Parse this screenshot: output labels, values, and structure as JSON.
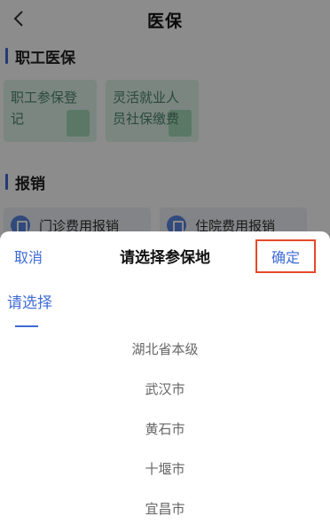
{
  "navbar": {
    "title": "医保"
  },
  "sections": {
    "employee": {
      "title": "职工医保",
      "cards": [
        {
          "label": "职工参保登记"
        },
        {
          "label": "灵活就业人员社保缴费"
        }
      ]
    },
    "reimburse": {
      "title": "报销",
      "items": [
        {
          "label": "门诊费用报销"
        },
        {
          "label": "住院费用报销"
        }
      ]
    }
  },
  "picker": {
    "cancel_label": "取消",
    "title": "请选择参保地",
    "confirm_label": "确定",
    "active_tab": "请选择",
    "options": [
      "湖北省本级",
      "武汉市",
      "黄石市",
      "十堰市",
      "宜昌市"
    ]
  },
  "colors": {
    "accent": "#3f6bd6",
    "highlight_border": "#e5492a",
    "card_bg": "#dff4e8"
  }
}
